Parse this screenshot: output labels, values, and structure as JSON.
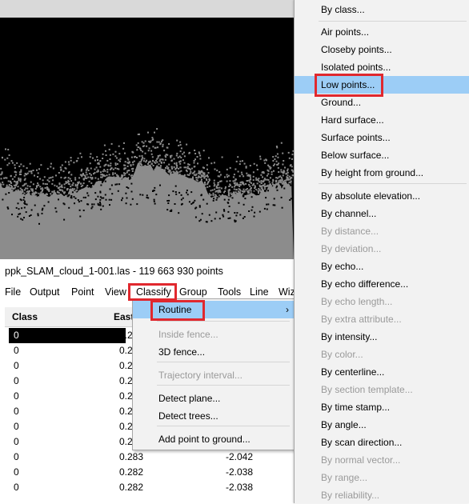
{
  "document": {
    "title": "ppk_SLAM_cloud_1-001.las - 119 663 930 points"
  },
  "menubar": [
    "File",
    "Output",
    "Point",
    "View",
    "Classify",
    "Group",
    "Tools",
    "Line",
    "Wiz"
  ],
  "table": {
    "headers": [
      "Class",
      "East",
      ""
    ],
    "rows": [
      [
        "0",
        "0.2",
        ""
      ],
      [
        "0",
        "0.2",
        ""
      ],
      [
        "0",
        "0.2",
        ""
      ],
      [
        "0",
        "0.2",
        ""
      ],
      [
        "0",
        "0.2",
        ""
      ],
      [
        "0",
        "0.2",
        ""
      ],
      [
        "0",
        "0.2",
        ""
      ],
      [
        "0",
        "0.2",
        ""
      ],
      [
        "0",
        "0.283",
        "-2.042"
      ],
      [
        "0",
        "0.282",
        "-2.038"
      ],
      [
        "0",
        "0.282",
        "-2.038"
      ]
    ]
  },
  "classify_menu": {
    "items": [
      {
        "label": "Routine",
        "has_submenu": true,
        "arrow": "›"
      },
      {
        "label": "Inside fence..."
      },
      {
        "label": "3D fence..."
      },
      {
        "label": "Trajectory interval..."
      },
      {
        "label": "Detect plane..."
      },
      {
        "label": "Detect trees..."
      },
      {
        "label": "Add point to ground..."
      }
    ]
  },
  "routine_submenu": {
    "items": [
      {
        "label": "By class..."
      },
      {
        "label": "Air points..."
      },
      {
        "label": "Closeby points..."
      },
      {
        "label": "Isolated points..."
      },
      {
        "label": "Low points..."
      },
      {
        "label": "Ground..."
      },
      {
        "label": "Hard surface..."
      },
      {
        "label": "Surface points..."
      },
      {
        "label": "Below surface..."
      },
      {
        "label": "By height from ground..."
      },
      {
        "label": "By absolute elevation..."
      },
      {
        "label": "By channel..."
      },
      {
        "label": "By distance..."
      },
      {
        "label": "By deviation..."
      },
      {
        "label": "By echo..."
      },
      {
        "label": "By echo difference..."
      },
      {
        "label": "By echo length..."
      },
      {
        "label": "By extra attribute..."
      },
      {
        "label": "By intensity..."
      },
      {
        "label": "By color..."
      },
      {
        "label": "By centerline..."
      },
      {
        "label": "By section template..."
      },
      {
        "label": "By time stamp..."
      },
      {
        "label": "By angle..."
      },
      {
        "label": "By scan direction..."
      },
      {
        "label": "By normal vector..."
      },
      {
        "label": "By range..."
      },
      {
        "label": "By reliability..."
      }
    ]
  },
  "colors": {
    "highlight": "#9ccdf6",
    "annotation": "#e0282e",
    "cloud_background": "#000000",
    "cloud_points": "#8c8c8c"
  }
}
